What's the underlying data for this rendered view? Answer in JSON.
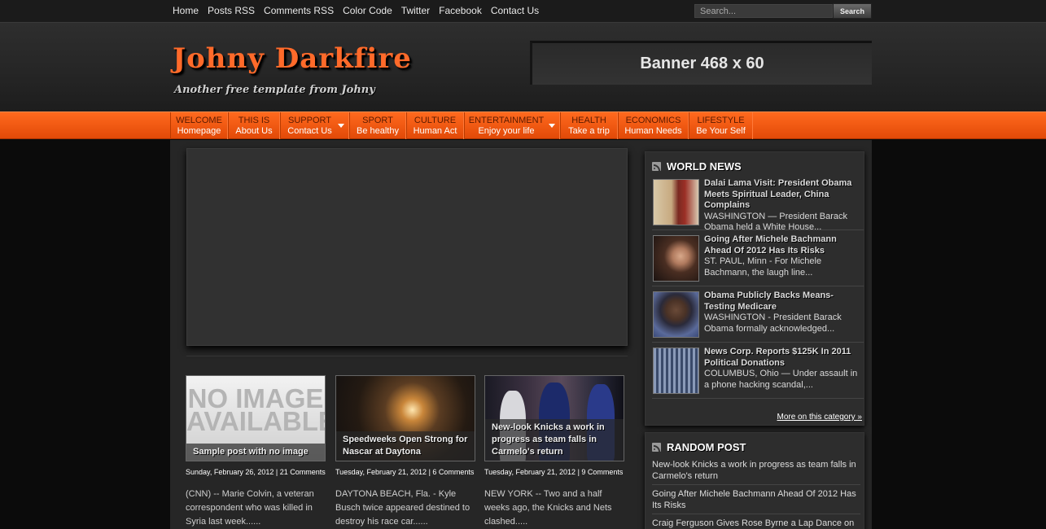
{
  "topbar": {
    "links": [
      "Home",
      "Posts RSS",
      "Comments RSS",
      "Color Code",
      "Twitter",
      "Facebook",
      "Contact Us"
    ],
    "search_placeholder": "Search...",
    "search_button": "Search"
  },
  "header": {
    "logo": "Johny Darkfire",
    "tagline": "Another free template from Johny",
    "banner": "Banner 468 x 60"
  },
  "nav": [
    {
      "top": "WELCOME",
      "bottom": "Homepage",
      "dropdown": false
    },
    {
      "top": "THIS IS",
      "bottom": "About Us",
      "dropdown": false
    },
    {
      "top": "SUPPORT",
      "bottom": "Contact Us",
      "dropdown": true
    },
    {
      "top": "SPORT",
      "bottom": "Be healthy",
      "dropdown": false
    },
    {
      "top": "CULTURE",
      "bottom": "Human Act",
      "dropdown": false
    },
    {
      "top": "ENTERTAINMENT",
      "bottom": "Enjoy your life",
      "dropdown": true
    },
    {
      "top": "HEALTH",
      "bottom": "Take a trip",
      "dropdown": false
    },
    {
      "top": "ECONOMICS",
      "bottom": "Human Needs",
      "dropdown": false
    },
    {
      "top": "LIFESTYLE",
      "bottom": "Be Your Self",
      "dropdown": false
    }
  ],
  "posts": [
    {
      "thumb_text": "NO IMAGE AVAILABLE",
      "caption": "Sample post with no image",
      "meta": "Sunday, February 26, 2012 | 21 Comments",
      "excerpt": "(CNN) -- Marie Colvin, a veteran correspondent who was killed in Syria last week......"
    },
    {
      "caption": "Speedweeks Open Strong for Nascar at Daytona",
      "meta": "Tuesday, February 21, 2012 | 6 Comments",
      "excerpt": "DAYTONA BEACH, Fla. - Kyle Busch twice appeared destined to destroy his race car......"
    },
    {
      "caption": "New-look Knicks a work in progress as team falls in Carmelo's return",
      "meta": "Tuesday, February 21, 2012 | 9 Comments",
      "excerpt": "NEW YORK -- Two and a half weeks ago, the Knicks and Nets clashed....."
    }
  ],
  "world_news": {
    "title": "WORLD NEWS",
    "items": [
      {
        "title": "Dalai Lama Visit: President Obama Meets Spiritual Leader, China Complains",
        "excerpt": "WASHINGTON — President Barack Obama held a White House..."
      },
      {
        "title": "Going After Michele Bachmann Ahead Of 2012 Has Its Risks",
        "excerpt": "ST. PAUL, Minn - For Michele Bachmann, the laugh line..."
      },
      {
        "title": "Obama Publicly Backs Means-Testing Medicare",
        "excerpt": "WASHINGTON - President Barack Obama formally acknowledged..."
      },
      {
        "title": "News Corp. Reports $125K In 2011 Political Donations",
        "excerpt": "COLUMBUS, Ohio — Under assault in a phone hacking scandal,..."
      }
    ],
    "more": "More on this category »"
  },
  "random_post": {
    "title": "RANDOM POST",
    "items": [
      "New-look Knicks a work in progress as team falls in Carmelo's return",
      "Going After Michele Bachmann Ahead Of 2012 Has Its Risks",
      "Craig Ferguson Gives Rose Byrne a Lap Dance on"
    ]
  }
}
